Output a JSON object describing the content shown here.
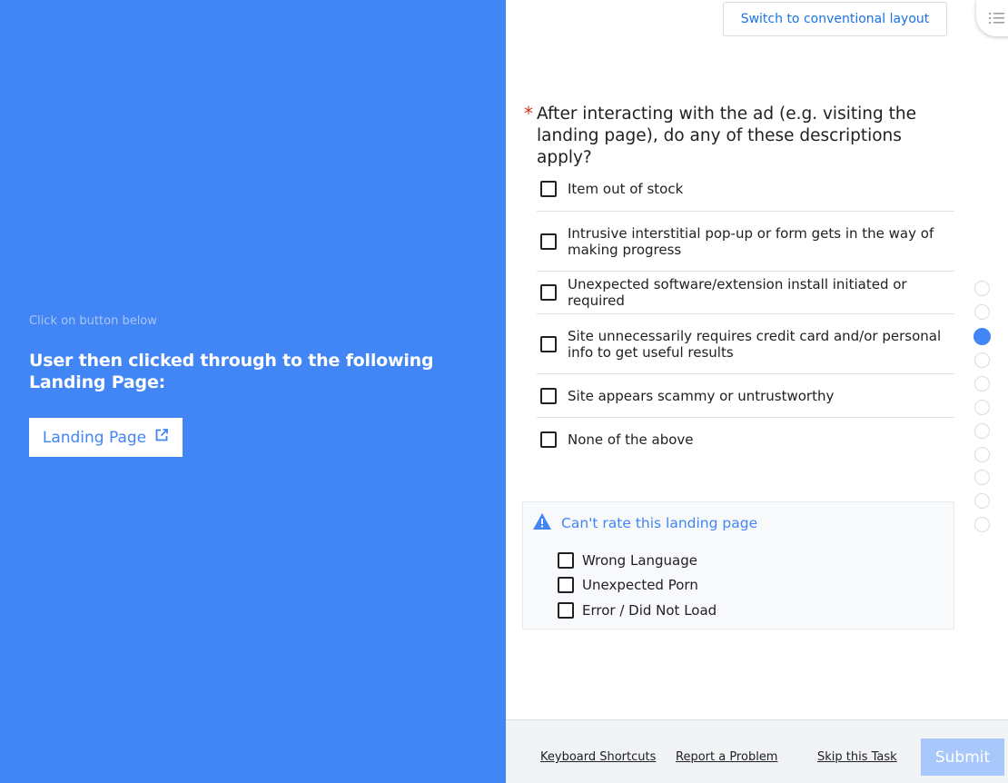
{
  "left": {
    "hint": "Click on button below",
    "heading": "User then clicked through to the following Landing Page:",
    "landing_button": "Landing Page"
  },
  "header": {
    "switch_layout": "Switch to conventional layout"
  },
  "question": {
    "required_marker": "*",
    "text": "After interacting with the ad (e.g. visiting the landing page), do any of these descriptions apply?",
    "options": [
      {
        "label": "Item out of stock",
        "checked": false
      },
      {
        "label": "Intrusive interstitial pop-up or form gets in the way of making progress",
        "checked": false
      },
      {
        "label": "Unexpected software/extension install initiated or required",
        "checked": false
      },
      {
        "label": "Site unnecessarily requires credit card and/or personal info to get useful results",
        "checked": false
      },
      {
        "label": "Site appears scammy or untrustworthy",
        "checked": false
      },
      {
        "label": "None of the above",
        "checked": false
      }
    ]
  },
  "cant_rate": {
    "title": "Can't rate this landing page",
    "options": [
      {
        "label": "Wrong Language",
        "checked": false
      },
      {
        "label": "Unexpected Porn",
        "checked": false
      },
      {
        "label": "Error / Did Not Load",
        "checked": false
      }
    ]
  },
  "progress": {
    "total_steps": 11,
    "current_step": 3
  },
  "footer": {
    "keyboard_shortcuts": "Keyboard Shortcuts",
    "report_problem": "Report a Problem",
    "skip_task": "Skip this Task",
    "submit": "Submit"
  },
  "colors": {
    "brand_blue": "#4285f4",
    "link_blue": "#1a73e8",
    "required_red": "#d93025",
    "submit_disabled": "#a8c7fa"
  },
  "icons": {
    "landing_button": "external-link-icon",
    "cant_rate": "warning-icon",
    "outline": "outline-list-icon"
  }
}
